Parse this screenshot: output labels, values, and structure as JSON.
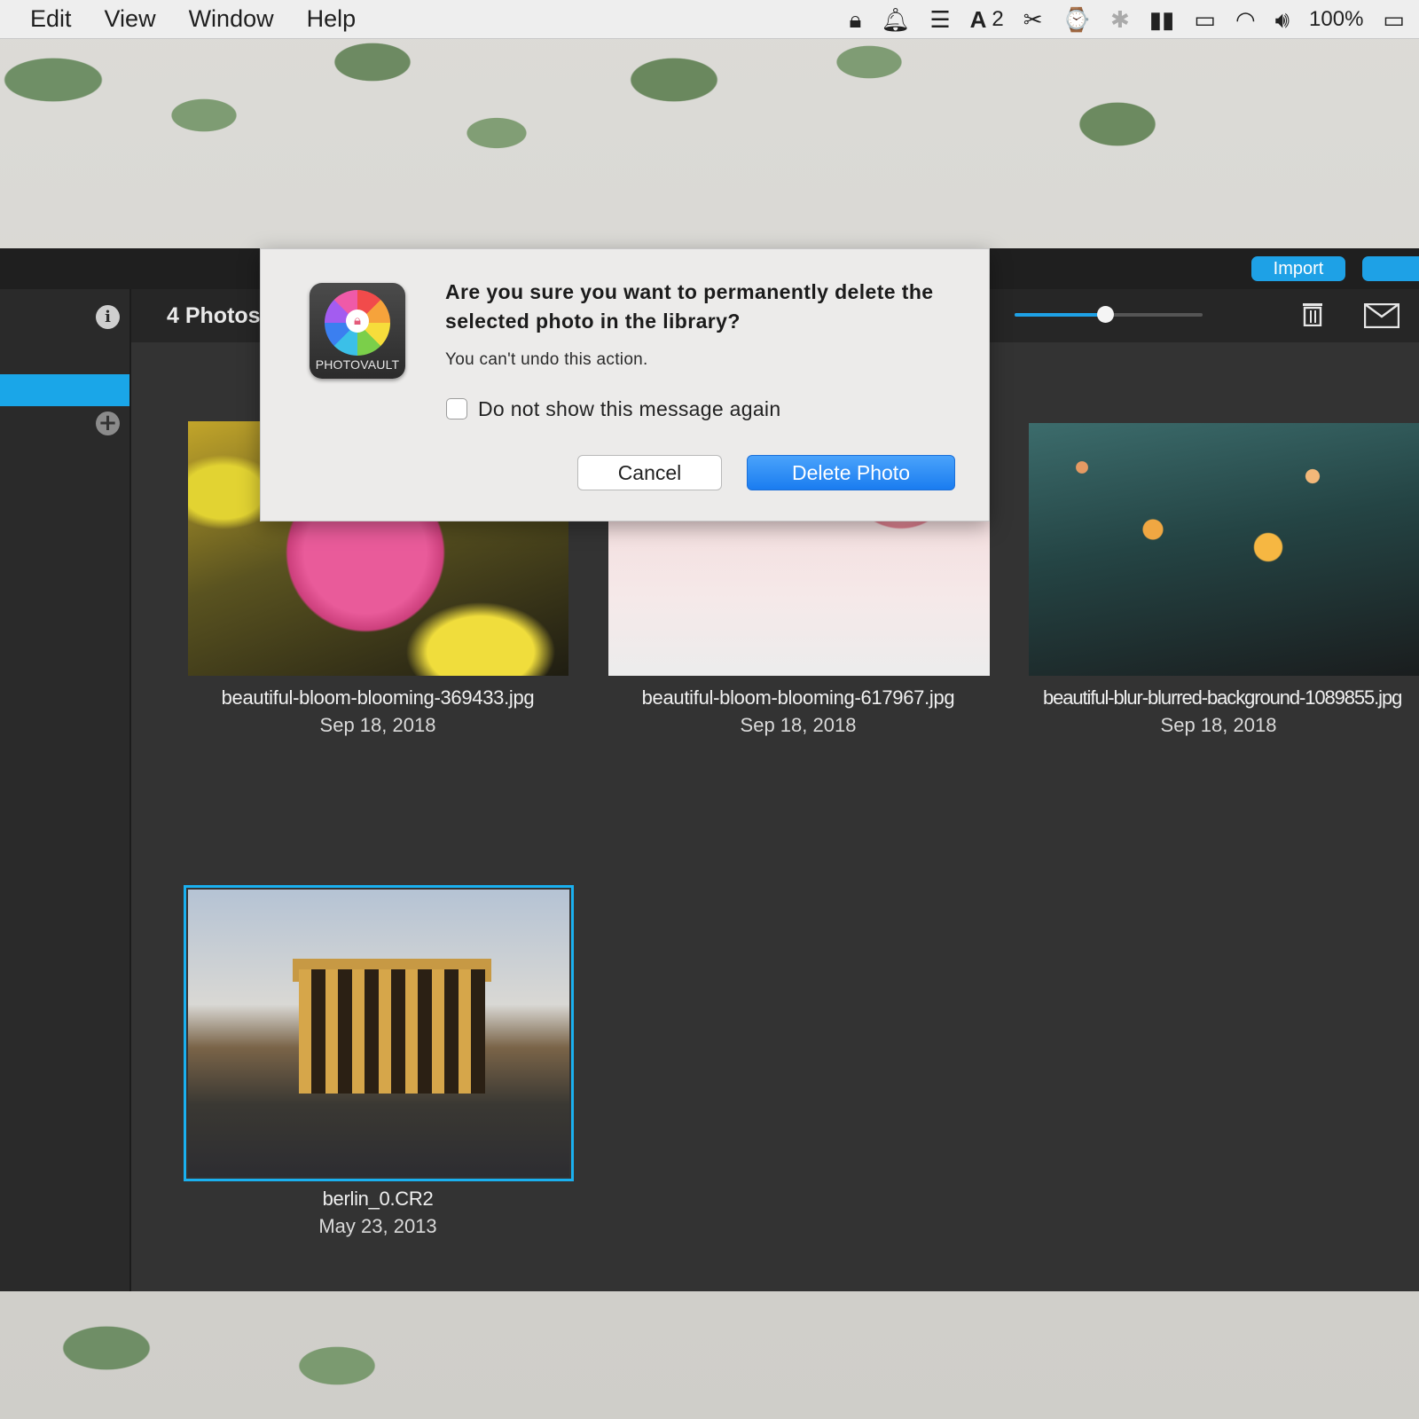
{
  "menubar": {
    "menus": [
      "Edit",
      "View",
      "Window",
      "Help"
    ],
    "status": {
      "adobe_count": "2",
      "battery": "100%"
    },
    "icons": [
      "lock-icon",
      "notification-icon",
      "stack-icon",
      "adobe-icon",
      "cut-icon",
      "time-machine-icon",
      "bluetooth-icon",
      "battery-bar-icon",
      "airplay-icon",
      "wifi-icon",
      "volume-icon",
      "battery-icon"
    ]
  },
  "toolbar": {
    "import_label": "Import"
  },
  "library": {
    "count_label": "4 Photos",
    "zoom_level": 0.48
  },
  "photos": [
    {
      "name": "beautiful-bloom-blooming-369433.jpg",
      "date": "Sep 18, 2018"
    },
    {
      "name": "beautiful-bloom-blooming-617967.jpg",
      "date": "Sep 18, 2018"
    },
    {
      "name": "beautiful-blur-blurred-background-1089855.jpg",
      "date": "Sep 18, 2018"
    },
    {
      "name": "berlin_0.CR2",
      "date": "May 23, 2013"
    }
  ],
  "dialog": {
    "app_name": "PHOTOVAULT",
    "title": "Are you sure you want to permanently delete the selected photo in the library?",
    "message": "You can't undo this action.",
    "checkbox_label": "Do not show this message again",
    "checkbox_checked": false,
    "cancel_label": "Cancel",
    "confirm_label": "Delete Photo"
  },
  "colors": {
    "accent": "#1ea1e6",
    "selection": "#1ab0ef",
    "default_button": "#1a7cf0"
  }
}
